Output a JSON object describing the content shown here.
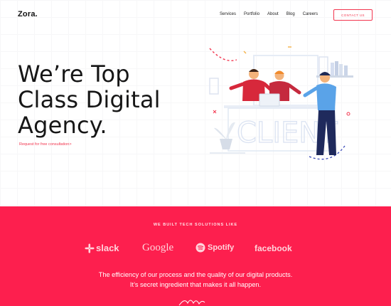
{
  "brand": {
    "logo": "Zora."
  },
  "nav": {
    "items": [
      {
        "label": "Services"
      },
      {
        "label": "Portfolio"
      },
      {
        "label": "About"
      },
      {
        "label": "Blog"
      },
      {
        "label": "Careers"
      }
    ],
    "cta": "CONTACT US"
  },
  "hero": {
    "title_lines": [
      "We’re Top",
      "Class Digital",
      "Agency."
    ],
    "link": "Request for free consultation",
    "illustration_sign": "CLIENT"
  },
  "solutions": {
    "heading": "WE BUILT TECH SOLUTIONS LIKE",
    "logos": [
      {
        "name": "slack",
        "icon": "slack-icon"
      },
      {
        "name": "Google"
      },
      {
        "name": "Spotify",
        "icon": "spotify-icon"
      },
      {
        "name": "facebook"
      }
    ],
    "blurb_lines": [
      "The efficiency of our process and the quality of our digital products.",
      "It’s secret ingredient that makes it all happen."
    ]
  },
  "colors": {
    "accent": "#fd1f4e",
    "text": "#161616"
  }
}
